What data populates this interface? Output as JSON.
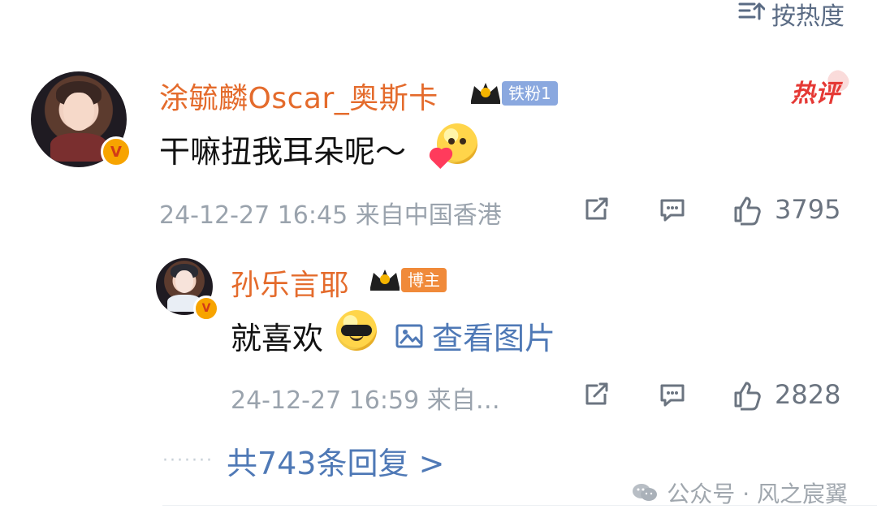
{
  "sort": {
    "label": "按热度",
    "icon": "sort-icon"
  },
  "comment": {
    "user": {
      "name": "涂毓麟Oscar_奥斯卡",
      "badge_fan": "铁粉1",
      "badge_hot": "热评",
      "verified_badge": "V",
      "avatar_icon": "avatar"
    },
    "text": "干嘛扭我耳朵呢～",
    "emoji": "blush-heart-emoji",
    "meta": "24-12-27 16:45 来自中国香港",
    "actions": {
      "share_icon": "share-icon",
      "comment_icon": "comment-icon",
      "like_icon": "thumbs-up-icon",
      "like_count": "3795"
    }
  },
  "reply": {
    "user": {
      "name": "孙乐言耶",
      "badge_owner": "博主",
      "verified_badge": "V",
      "avatar_icon": "avatar"
    },
    "text": "就喜欢",
    "emoji": "sunglasses-emoji",
    "view_image": "查看图片",
    "meta": "24-12-27 16:59 来自…",
    "actions": {
      "share_icon": "share-icon",
      "comment_icon": "comment-icon",
      "like_icon": "thumbs-up-icon",
      "like_count": "2828"
    }
  },
  "replies_link": "共743条回复 >",
  "watermark": "公众号 · 风之宸翼",
  "colors": {
    "name_orange": "#e46b2c",
    "link_blue": "#4f79b6",
    "meta_gray": "#9aa3ad",
    "hot_red": "#e53935"
  }
}
